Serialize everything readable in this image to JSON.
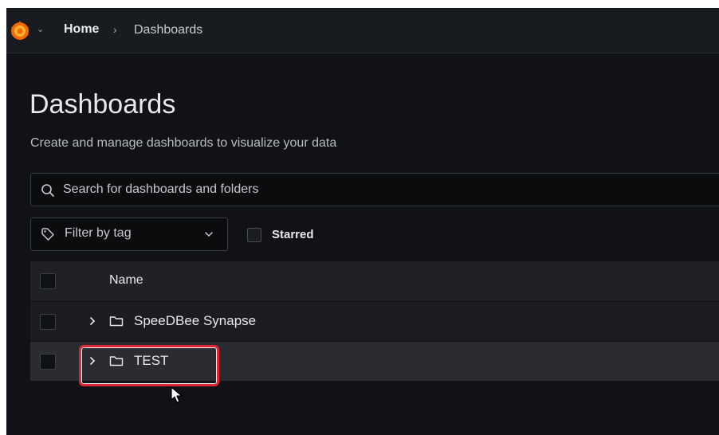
{
  "colors": {
    "background": "#111217",
    "topbar": "#181b1f",
    "highlight": "#e02434",
    "logo": "#f46800"
  },
  "topbar": {
    "logo_icon": "grafana-logo",
    "caret_glyph": "⌄",
    "breadcrumb": {
      "home": "Home",
      "separator": "›",
      "current": "Dashboards"
    }
  },
  "page": {
    "title": "Dashboards",
    "subtitle": "Create and manage dashboards to visualize your data"
  },
  "search": {
    "icon": "search-icon",
    "placeholder": "Search for dashboards and folders",
    "value": ""
  },
  "filters": {
    "tag_filter_label": "Filter by tag",
    "tag_icon": "tag-icon",
    "starred_label": "Starred",
    "starred_checked": false
  },
  "table": {
    "header": {
      "name": "Name"
    },
    "rows": [
      {
        "name": "SpeeDBee Synapse",
        "type": "folder",
        "expanded": false,
        "hovered": false
      },
      {
        "name": "TEST",
        "type": "folder",
        "expanded": false,
        "hovered": true,
        "highlighted": true
      }
    ]
  }
}
